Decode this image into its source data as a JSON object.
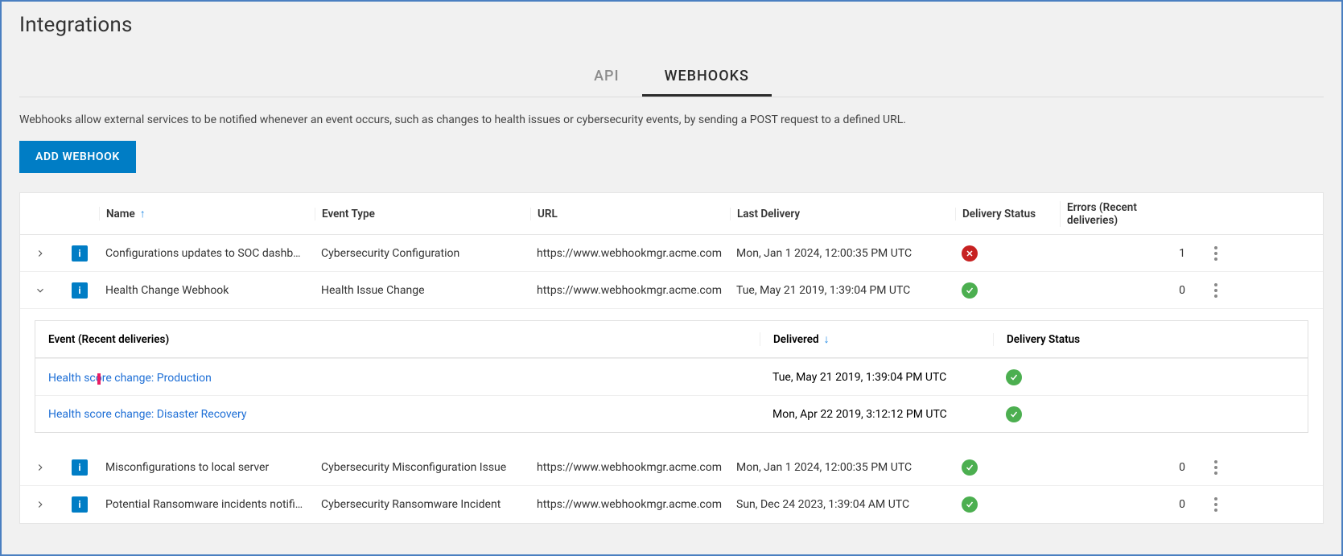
{
  "page": {
    "title": "Integrations",
    "description": "Webhooks allow external services to be notified whenever an event occurs, such as changes to health issues or cybersecurity events, by sending a POST request to a defined URL."
  },
  "tabs": {
    "api": "API",
    "webhooks": "WEBHOOKS"
  },
  "buttons": {
    "add_webhook": "ADD WEBHOOK"
  },
  "columns": {
    "name": "Name",
    "event_type": "Event Type",
    "url": "URL",
    "last_delivery": "Last Delivery",
    "delivery_status": "Delivery Status",
    "errors": "Errors (Recent deliveries)"
  },
  "rows": [
    {
      "expanded": false,
      "name": "Configurations updates to SOC dashb…",
      "event_type": "Cybersecurity Configuration",
      "url": "https://www.webhookmgr.acme.com",
      "last_delivery": "Mon, Jan 1 2024, 12:00:35 PM UTC",
      "status": "fail",
      "errors": "1"
    },
    {
      "expanded": true,
      "name": "Health Change Webhook",
      "event_type": "Health Issue Change",
      "url": "https://www.webhookmgr.acme.com",
      "last_delivery": "Tue, May 21 2019, 1:39:04 PM UTC",
      "status": "success",
      "errors": "0"
    },
    {
      "expanded": false,
      "name": "Misconfigurations to local server",
      "event_type": "Cybersecurity Misconfiguration Issue",
      "url": "https://www.webhookmgr.acme.com",
      "last_delivery": "Mon, Jan 1 2024, 12:00:35 PM UTC",
      "status": "success",
      "errors": "0"
    },
    {
      "expanded": false,
      "name": "Potential Ransomware incidents notifi…",
      "event_type": "Cybersecurity Ransomware Incident",
      "url": "https://www.webhookmgr.acme.com",
      "last_delivery": "Sun, Dec 24 2023, 1:39:04 AM UTC",
      "status": "success",
      "errors": "0"
    }
  ],
  "nested": {
    "columns": {
      "event": "Event (Recent deliveries)",
      "delivered": "Delivered",
      "delivery_status": "Delivery Status"
    },
    "rows": [
      {
        "event": "Health score change: Production",
        "delivered": "Tue, May 21 2019, 1:39:04 PM UTC",
        "status": "success"
      },
      {
        "event": "Health score change: Disaster Recovery",
        "delivered": "Mon, Apr 22 2019, 3:12:12 PM UTC",
        "status": "success"
      }
    ]
  }
}
